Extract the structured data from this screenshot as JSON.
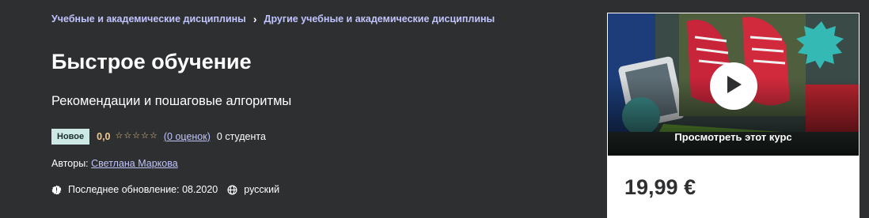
{
  "breadcrumb": {
    "items": [
      "Учебные и академические дисциплины",
      "Другие учебные и академические дисциплины"
    ],
    "separator": "›"
  },
  "course": {
    "title": "Быстрое обучение",
    "subtitle": "Рекомендации и пошаговые алгоритмы",
    "badge": "Новое",
    "rating": "0,0",
    "rating_value": 0,
    "ratings_count_label": "(0 оценок)",
    "students": "0 студента",
    "authors_label": "Авторы:",
    "author_name": "Светлана Маркова",
    "last_updated": "Последнее обновление: 08.2020",
    "language": "русский"
  },
  "card": {
    "preview_label": "Просмотреть этот курс",
    "price": "19,99 €"
  },
  "icons": {
    "star": "star-outline-icon",
    "updated": "alert-badge-icon",
    "language": "globe-icon",
    "play": "play-icon"
  },
  "colors": {
    "background": "#2d2f31",
    "link": "#c0c4fc",
    "rating": "#f3ca8c",
    "badge": "#cde9e6"
  }
}
